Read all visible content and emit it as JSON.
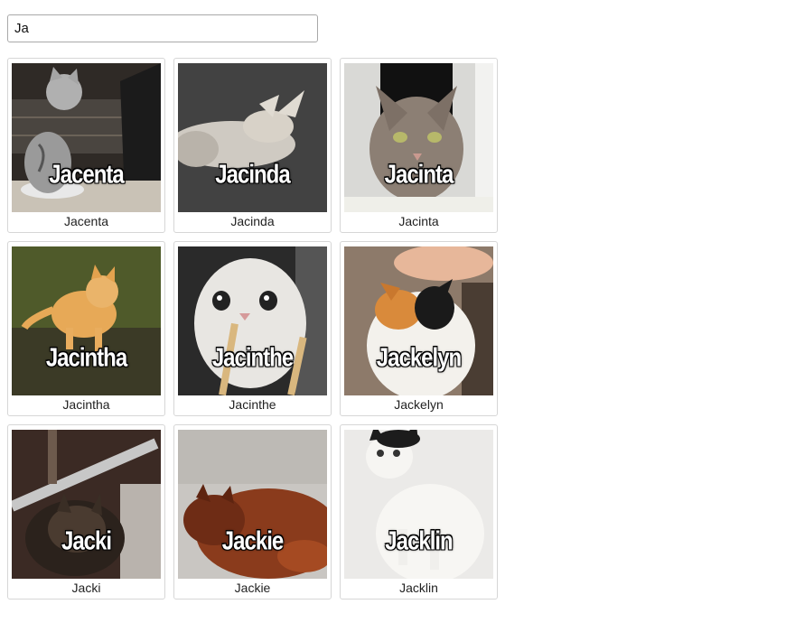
{
  "search": {
    "value": "Ja"
  },
  "cards": [
    {
      "name": "Jacenta",
      "overlay": "Jacenta",
      "photo": "cat-at-laptop-photo"
    },
    {
      "name": "Jacinda",
      "overlay": "Jacinda",
      "photo": "cat-on-back-photo"
    },
    {
      "name": "Jacinta",
      "overlay": "Jacinta",
      "photo": "tabby-cat-portrait-photo"
    },
    {
      "name": "Jacintha",
      "overlay": "Jacintha",
      "photo": "orange-kitten-photo"
    },
    {
      "name": "Jacinthe",
      "overlay": "Jacinthe",
      "photo": "white-cat-with-sticks-photo"
    },
    {
      "name": "Jackelyn",
      "overlay": "Jackelyn",
      "photo": "calico-cat-photo"
    },
    {
      "name": "Jacki",
      "overlay": "Jacki",
      "photo": "cat-by-railing-photo"
    },
    {
      "name": "Jackie",
      "overlay": "Jackie",
      "photo": "ginger-cat-lying-photo"
    },
    {
      "name": "Jacklin",
      "overlay": "Jacklin",
      "photo": "black-white-cat-photo"
    }
  ]
}
